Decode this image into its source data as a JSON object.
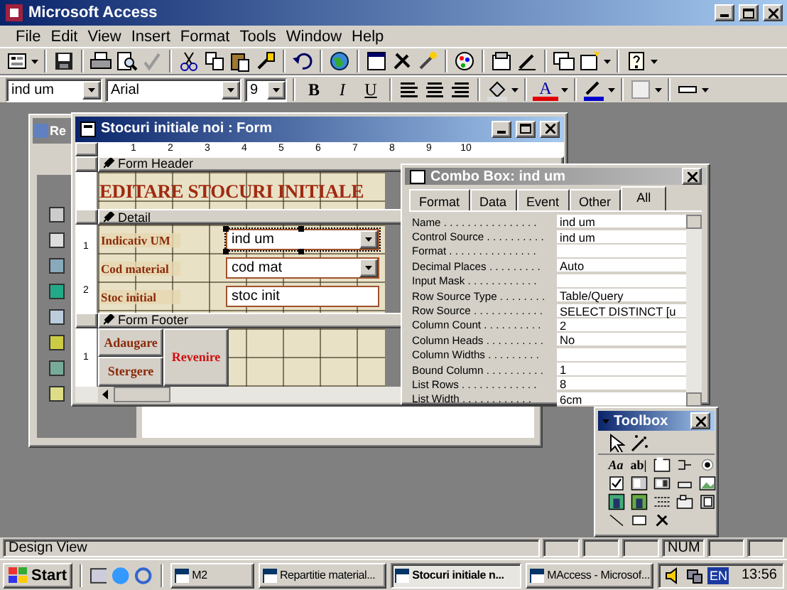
{
  "app_title": "Microsoft Access",
  "menu": [
    "File",
    "Edit",
    "View",
    "Insert",
    "Format",
    "Tools",
    "Window",
    "Help"
  ],
  "formatting_toolbar": {
    "object": "ind um",
    "font": "Arial",
    "size": "9",
    "style_buttons": [
      "B",
      "I",
      "U"
    ],
    "font_color_glyph": "A"
  },
  "database_window": {
    "title": "Re"
  },
  "form_window": {
    "title": "Stocuri initiale noi : Form",
    "ruler_marks": [
      "1",
      "2",
      "3",
      "4",
      "5",
      "6",
      "7",
      "8",
      "9",
      "10"
    ],
    "sections": [
      {
        "name": "Form Header",
        "kind": "header",
        "title": "EDITARE STOCURI INITIALE"
      },
      {
        "name": "Detail",
        "kind": "detail",
        "ruler_marks": [
          "1",
          "2"
        ],
        "fields": [
          {
            "label": "Indicativ UM",
            "value": "ind um",
            "kind": "combo",
            "selected": true
          },
          {
            "label": "Cod material",
            "value": "cod mat",
            "kind": "combo",
            "selected": false
          },
          {
            "label": "Stoc initial",
            "value": "stoc init",
            "kind": "text",
            "selected": false
          }
        ]
      },
      {
        "name": "Form Footer",
        "kind": "footer",
        "ruler_marks": [
          "1"
        ],
        "buttons": [
          {
            "label": "Adaugare",
            "color": "#8b2a0a"
          },
          {
            "label": "Stergere",
            "color": "#8b2a0a"
          },
          {
            "label": "Revenire",
            "color": "#d01010"
          }
        ]
      }
    ]
  },
  "property_sheet": {
    "title": "Combo Box: ind um",
    "tabs": [
      {
        "label": "Format",
        "selected": false
      },
      {
        "label": "Data",
        "selected": false
      },
      {
        "label": "Event",
        "selected": false
      },
      {
        "label": "Other",
        "selected": false
      },
      {
        "label": "All",
        "selected": true
      }
    ],
    "properties": [
      {
        "name": "Name . . . . . . . . . . . . . . . . ",
        "value": "ind um"
      },
      {
        "name": "Control Source . . . . . . . . . . ",
        "value": "ind um"
      },
      {
        "name": "Format . . . . . . . . . . . . . . . "
      },
      {
        "name": "Decimal Places . . . . . . . . . ",
        "value": "Auto"
      },
      {
        "name": "Input Mask . . . . . . . . . . . . "
      },
      {
        "name": "Row Source Type . . . . . . . . ",
        "value": "Table/Query"
      },
      {
        "name": "Row Source . . . . . . . . . . . . ",
        "value": "SELECT DISTINCT [u"
      },
      {
        "name": "Column Count . . . . . . . . . . ",
        "value": "2"
      },
      {
        "name": "Column Heads . . . . . . . . . . ",
        "value": "No"
      },
      {
        "name": "Column Widths . . . . . . . . . "
      },
      {
        "name": "Bound Column . . . . . . . . . . ",
        "value": "1"
      },
      {
        "name": "List Rows . . . . . . . . . . . . . ",
        "value": "8"
      },
      {
        "name": "List Width . . . . . . . . . . . . ",
        "value": "6cm"
      }
    ]
  },
  "toolbox": {
    "title": "Toolbox",
    "text_tools": [
      "Aa",
      "ab|"
    ]
  },
  "status_bar": {
    "text": "Design View",
    "indicators": [
      "NUM"
    ]
  },
  "taskbar": {
    "start": "Start",
    "tasks": [
      {
        "label": "M2",
        "selected": false
      },
      {
        "label": "Repartitie material...",
        "selected": false
      },
      {
        "label": "Stocuri initiale n...",
        "selected": true
      },
      {
        "label": "MAccess - Microsof...",
        "selected": false
      }
    ],
    "language": "EN",
    "clock": "13:56"
  }
}
